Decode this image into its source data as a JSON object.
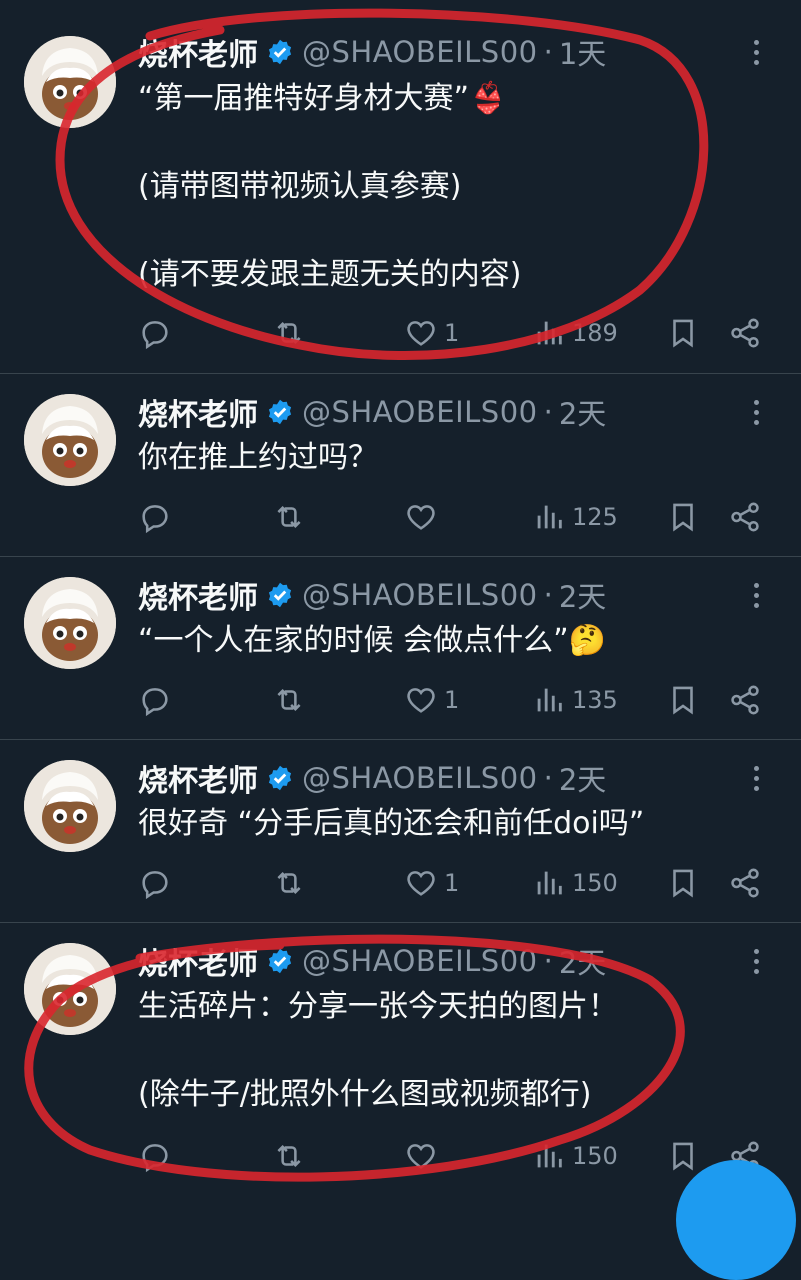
{
  "tweets": [
    {
      "name": "烧杯老师",
      "handle": "@SHAOBEILS00",
      "time": "1天",
      "lines": [
        "“第一届推特好身材大赛”👙",
        "",
        "(请带图带视频认真参赛)",
        "",
        "(请不要发跟主题无关的内容)"
      ],
      "likes": "1",
      "views": "189"
    },
    {
      "name": "烧杯老师",
      "handle": "@SHAOBEILS00",
      "time": "2天",
      "lines": [
        "你在推上约过吗？"
      ],
      "likes": "",
      "views": "125"
    },
    {
      "name": "烧杯老师",
      "handle": "@SHAOBEILS00",
      "time": "2天",
      "lines": [
        "“一个人在家的时候 会做点什么”🤔"
      ],
      "likes": "1",
      "views": "135"
    },
    {
      "name": "烧杯老师",
      "handle": "@SHAOBEILS00",
      "time": "2天",
      "lines": [
        "很好奇 “分手后真的还会和前任doi吗”"
      ],
      "likes": "1",
      "views": "150"
    },
    {
      "name": "烧杯老师",
      "handle": "@SHAOBEILS00",
      "time": "2天",
      "lines": [
        "生活碎片：分享一张今天拍的图片！",
        "",
        "(除牛子/批照外什么图或视频都行)"
      ],
      "likes": "",
      "views": "150"
    }
  ],
  "dot_separator": "·",
  "colors": {
    "background": "#15202b",
    "muted": "#8b98a5",
    "verified": "#1d9bf0",
    "annotation": "#d9262e"
  },
  "icons": [
    "reply-icon",
    "retweet-icon",
    "like-icon",
    "views-icon",
    "bookmark-icon",
    "share-icon",
    "verified-badge-icon",
    "more-options-icon"
  ]
}
